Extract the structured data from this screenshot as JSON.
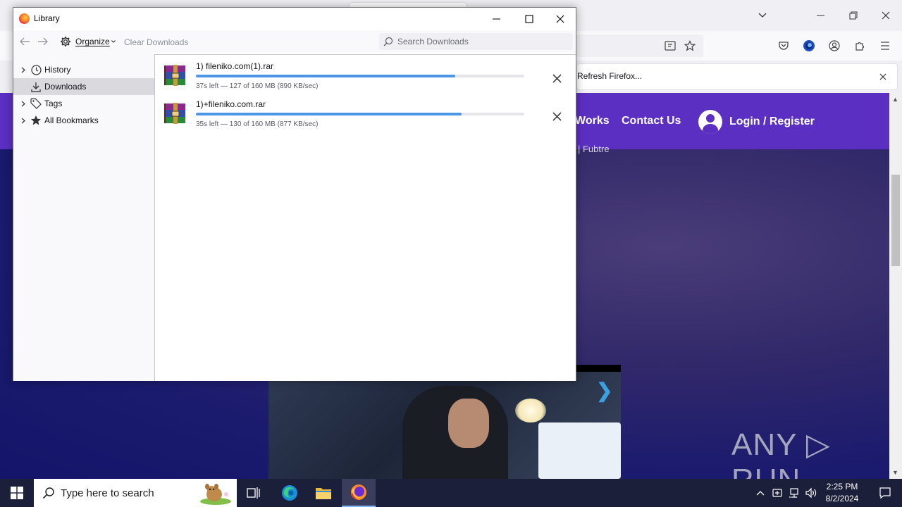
{
  "browser": {
    "notification": {
      "button_label": "Refresh Firefox..."
    },
    "site": {
      "nav": {
        "how_it_works": "Works",
        "contact": "Contact Us",
        "login": "Login / Register"
      },
      "subtext": "| Fubtre"
    },
    "watermark": "ANY ▷ RUN"
  },
  "library": {
    "title": "Library",
    "toolbar": {
      "organize_label": "Organize",
      "clear_label": "Clear Downloads",
      "search_placeholder": "Search Downloads"
    },
    "sidebar": {
      "items": [
        {
          "label": "History",
          "icon": "clock-icon",
          "expandable": true
        },
        {
          "label": "Downloads",
          "icon": "download-icon",
          "expandable": false,
          "selected": true
        },
        {
          "label": "Tags",
          "icon": "tag-icon",
          "expandable": true
        },
        {
          "label": "All Bookmarks",
          "icon": "star-icon",
          "expandable": true
        }
      ]
    },
    "downloads": [
      {
        "name": "1) fileniko.com(1).rar",
        "status": "37s left — 127 of 160 MB (890 KB/sec)",
        "progress": 0.79
      },
      {
        "name": "1)+fileniko.com.rar",
        "status": "35s left — 130 of 160 MB (877 KB/sec)",
        "progress": 0.81
      }
    ]
  },
  "taskbar": {
    "search_placeholder": "Type here to search",
    "time": "2:25 PM",
    "date": "8/2/2024"
  },
  "colors": {
    "site_header": "#5b2fc2",
    "progress_fill": "#4b96e6",
    "taskbar": "#1c1f3a"
  }
}
